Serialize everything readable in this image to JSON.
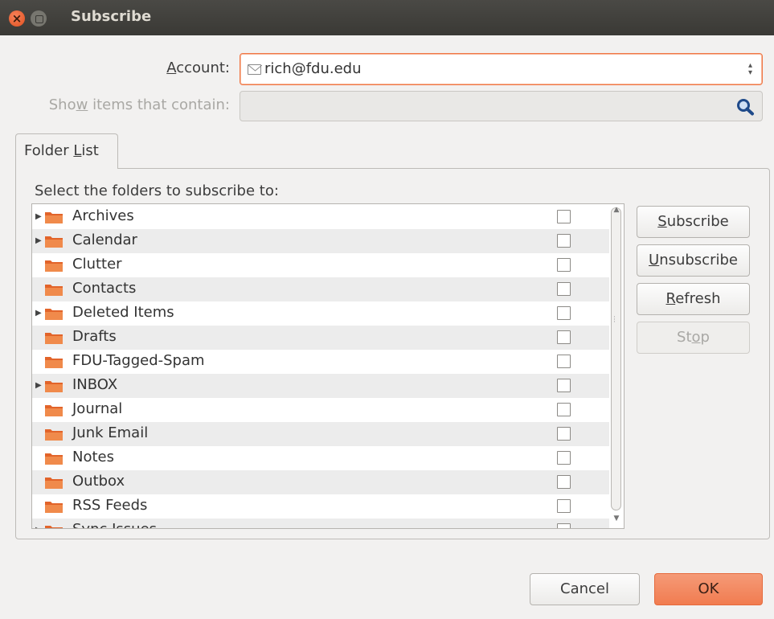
{
  "window": {
    "title": "Subscribe"
  },
  "account": {
    "label_prefix": "A",
    "label_underlined": "",
    "label_rest": "ccount:",
    "value": "rich@fdu.edu"
  },
  "filter": {
    "label_prefix": "Sho",
    "label_underlined": "w",
    "label_rest": " items that contain:",
    "value": "",
    "placeholder": ""
  },
  "tab": {
    "label_prefix": "Folder ",
    "label_underlined": "L",
    "label_rest": "ist"
  },
  "instructions": "Select the folders to subscribe to:",
  "folders": [
    {
      "name": "Archives",
      "expandable": true,
      "checked": false
    },
    {
      "name": "Calendar",
      "expandable": true,
      "checked": false
    },
    {
      "name": "Clutter",
      "expandable": false,
      "checked": false
    },
    {
      "name": "Contacts",
      "expandable": false,
      "checked": false
    },
    {
      "name": "Deleted Items",
      "expandable": true,
      "checked": false
    },
    {
      "name": "Drafts",
      "expandable": false,
      "checked": false
    },
    {
      "name": "FDU-Tagged-Spam",
      "expandable": false,
      "checked": false
    },
    {
      "name": "INBOX",
      "expandable": true,
      "checked": false
    },
    {
      "name": "Journal",
      "expandable": false,
      "checked": false
    },
    {
      "name": "Junk Email",
      "expandable": false,
      "checked": false
    },
    {
      "name": "Notes",
      "expandable": false,
      "checked": false
    },
    {
      "name": "Outbox",
      "expandable": false,
      "checked": false
    },
    {
      "name": "RSS Feeds",
      "expandable": false,
      "checked": false
    },
    {
      "name": "Sync Issues",
      "expandable": true,
      "checked": false
    }
  ],
  "side_buttons": {
    "subscribe": {
      "u": "S",
      "rest": "ubscribe"
    },
    "unsubscribe": {
      "u": "U",
      "rest": "nsubscribe"
    },
    "refresh": {
      "u": "R",
      "rest": "efresh"
    },
    "stop": {
      "pre": "St",
      "u": "o",
      "rest": "p"
    }
  },
  "footer": {
    "cancel": "Cancel",
    "ok": "OK"
  },
  "colors": {
    "accent": "#f07746",
    "folder": "#e2642a",
    "titlebar": "#3c3b37"
  }
}
